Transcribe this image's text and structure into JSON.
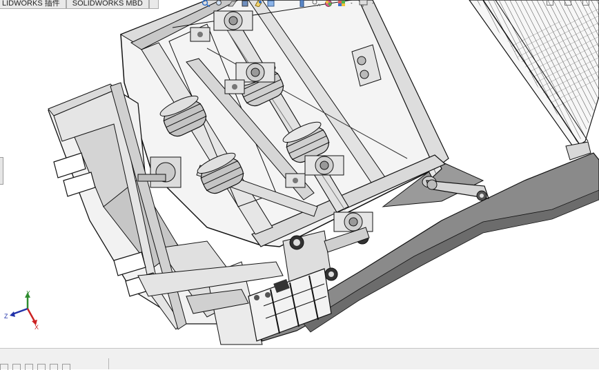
{
  "tabs": [
    {
      "label": "LIDWORKS 插件"
    },
    {
      "label": "SOLIDWORKS MBD"
    }
  ],
  "triad": {
    "y": "Y",
    "z": "Z",
    "x": "X"
  },
  "icons": {
    "view_toolbar": [
      "zoom-to-fit-icon",
      "zoom-area-icon",
      "section-view-icon",
      "display-style-icon",
      "view-orientation-icon",
      "hide-show-icon",
      "appearance-icon",
      "scene-icon",
      "monitor-icon"
    ],
    "window_controls": [
      "minimize-icon",
      "restore-icon",
      "close-icon"
    ],
    "bottom_toolbar": [
      "rebuild-icon",
      "sketch-icon",
      "dimension-icon",
      "relation-icon",
      "grid-icon",
      "arrow-icon"
    ]
  },
  "colors": {
    "model_fill": "#e3e3e3",
    "model_dark": "#6c6c6c",
    "edge": "#111111",
    "triad_y": "#2e8b2e",
    "triad_x": "#cc2222",
    "triad_z": "#2233aa"
  }
}
